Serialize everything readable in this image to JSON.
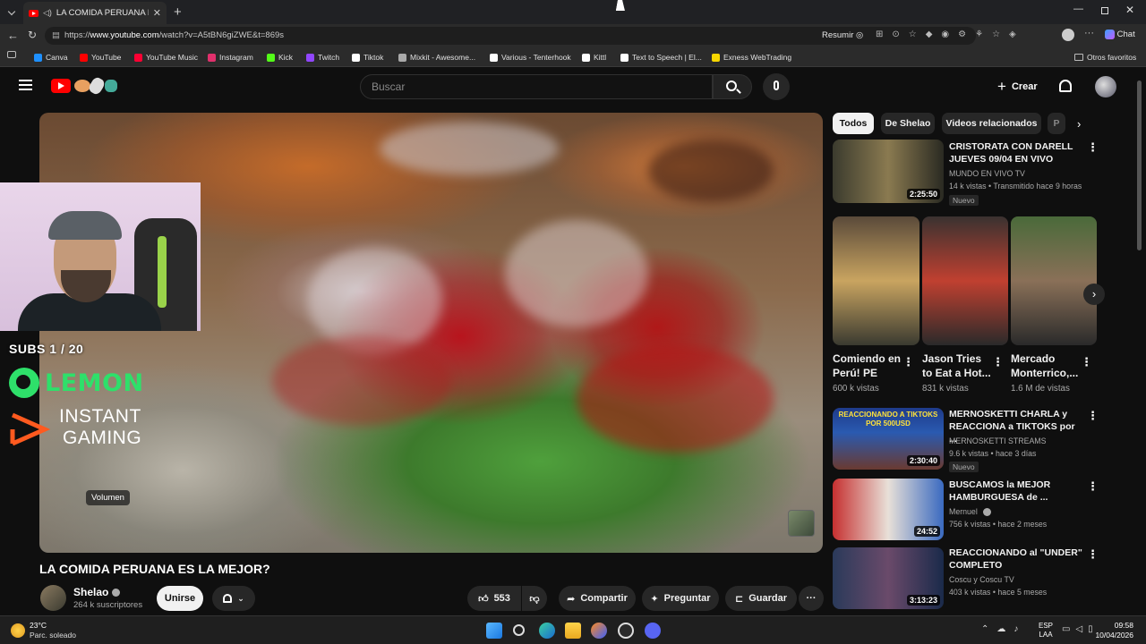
{
  "browser": {
    "tab_title": "LA COMIDA PERUANA ES LA MEJOR",
    "new_tab": "+",
    "url_prefix": "https://",
    "url_domain": "www.youtube.com",
    "url_rest": "/watch?v=A5tBN6giZWE&t=869s",
    "resumir": "Resumir",
    "chat": "Chat",
    "bookmarks": [
      {
        "label": "Canva",
        "color": "#1e90ff"
      },
      {
        "label": "YouTube",
        "color": "#ff0000"
      },
      {
        "label": "YouTube Music",
        "color": "#ff0033"
      },
      {
        "label": "Instagram",
        "color": "#e1306c"
      },
      {
        "label": "Kick",
        "color": "#53fc18"
      },
      {
        "label": "Twitch",
        "color": "#9146ff"
      },
      {
        "label": "Tiktok",
        "color": "#ffffff"
      },
      {
        "label": "Mixkit - Awesome...",
        "color": "#aaaaaa"
      },
      {
        "label": "Various - Tenterhook",
        "color": "#ffffff"
      },
      {
        "label": "Kittl",
        "color": "#ffffff"
      },
      {
        "label": "Text to Speech | El...",
        "color": "#ffffff"
      },
      {
        "label": "Exness WebTrading",
        "color": "#f6d600"
      }
    ],
    "other_favorites": "Otros favoritos"
  },
  "youtube": {
    "search_placeholder": "Buscar",
    "create_label": "Crear"
  },
  "player": {
    "volume_tooltip": "Volumen"
  },
  "overlay": {
    "subs": "SUBS 1 / 20",
    "lemon": "LEMON",
    "instant": "INSTANT",
    "gaming": "GAMING"
  },
  "video": {
    "title": "LA COMIDA PERUANA ES LA MEJOR?",
    "channel": "Shelao",
    "subscribers": "264 k suscriptores",
    "join": "Unirse",
    "likes": "553",
    "share": "Compartir",
    "ask": "Preguntar",
    "save": "Guardar"
  },
  "sidebar": {
    "chips": [
      "Todos",
      "De Shelao",
      "Videos relacionados",
      "P"
    ],
    "videos": [
      {
        "title": "CRISTORATA CON DARELL JUEVES 09/04 EN VIVO",
        "channel": "MUNDO EN VIVO TV",
        "meta": "14 k vistas • Transmitido hace 9 horas",
        "duration": "2:25:50",
        "badge": "Nuevo"
      },
      {
        "title": "MERNOSKETTI CHARLA y REACCIONA a TIKTOKS por ...",
        "channel": "MERNOSKETTI STREAMS",
        "meta": "9.6 k vistas • hace 3 días",
        "duration": "2:30:40",
        "badge": "Nuevo"
      },
      {
        "title": "BUSCAMOS la MEJOR HAMBURGUESA de ...",
        "channel": "Mernuel",
        "meta": "756 k vistas • hace 2 meses",
        "duration": "24:52",
        "badge": ""
      },
      {
        "title": "REACCIONANDO al \"UNDER\" COMPLETO",
        "channel": "Coscu y Coscu TV",
        "meta": "403 k vistas • hace 5 meses",
        "duration": "3:13:23",
        "badge": ""
      }
    ],
    "shorts": [
      {
        "title": "Comiendo en Perú! PE",
        "views": "600 k vistas"
      },
      {
        "title": "Jason Tries to Eat a Hot...",
        "views": "831 k vistas"
      },
      {
        "title": "Mercado Monterrico,...",
        "views": "1.6 M de vistas"
      }
    ],
    "thumb_text": "REACCIONANDO A TIKTOKS POR 500USD"
  },
  "taskbar": {
    "temp": "23°C",
    "weather": "Parc. soleado",
    "lang1": "ESP",
    "lang2": "LAA",
    "time": "09:58",
    "date": "10/04/2026"
  }
}
